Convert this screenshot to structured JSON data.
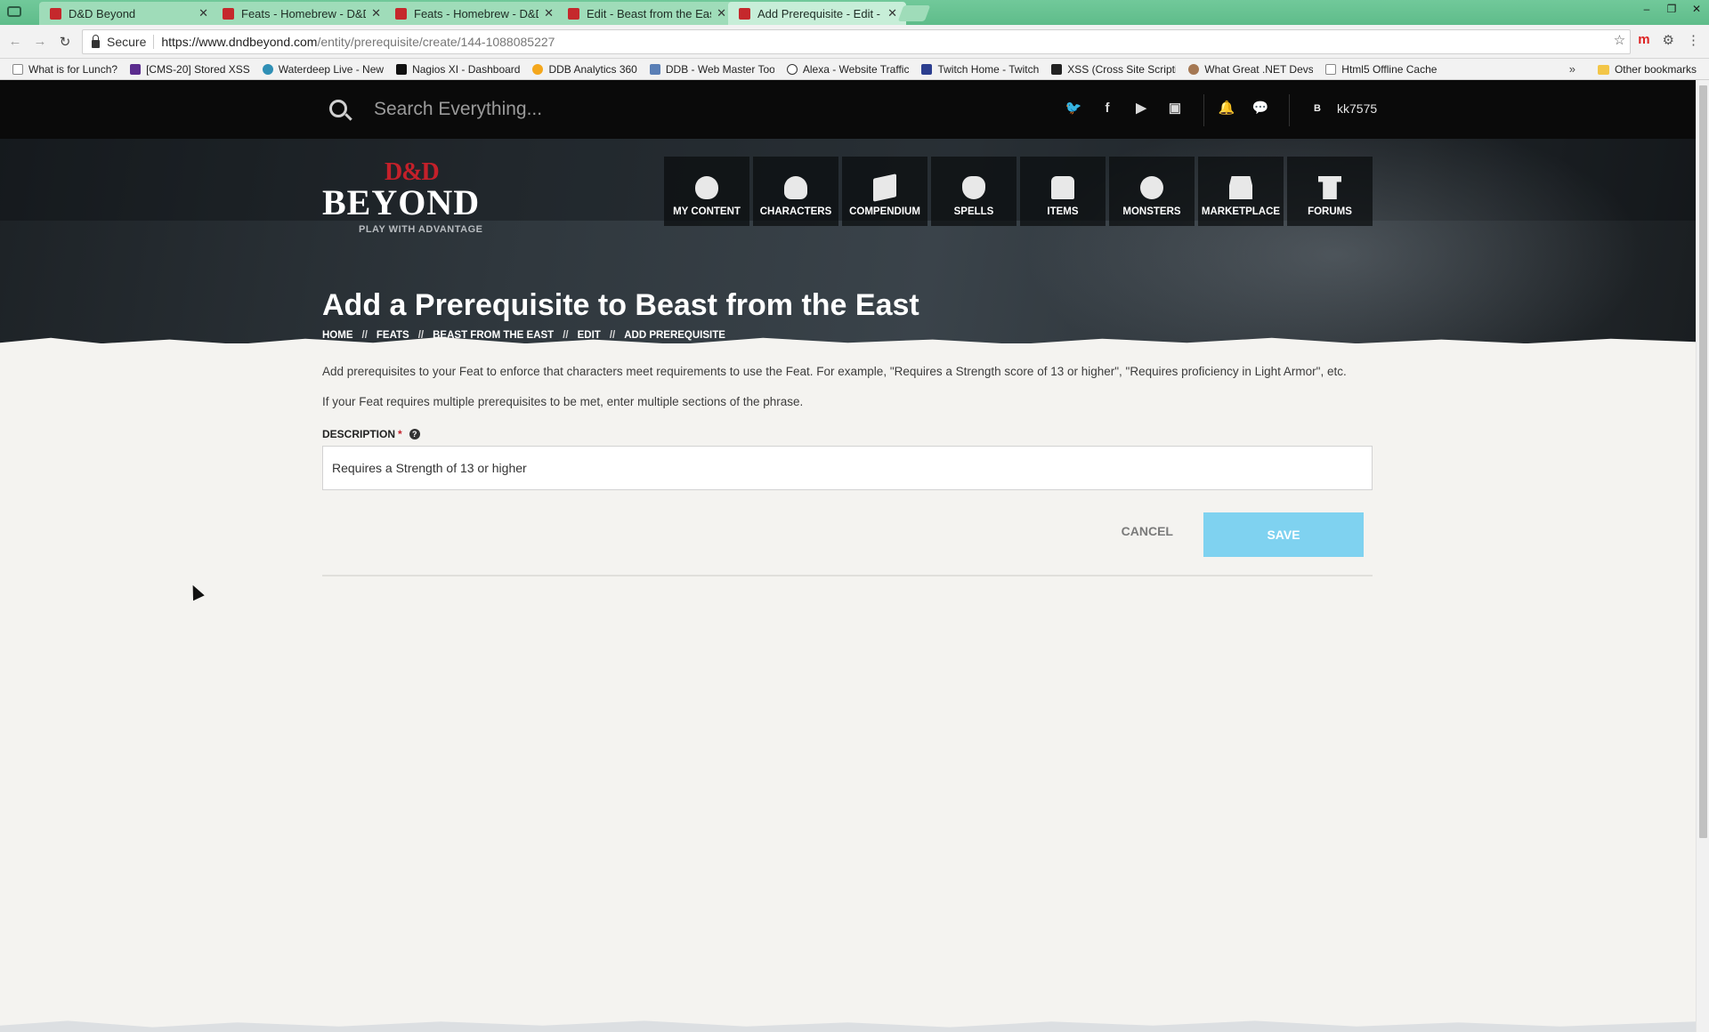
{
  "browser": {
    "tabs": [
      {
        "label": "D&D Beyond"
      },
      {
        "label": "Feats - Homebrew - D&D"
      },
      {
        "label": "Feats - Homebrew - D&D"
      },
      {
        "label": "Edit - Beast from the East"
      },
      {
        "label": "Add Prerequisite - Edit -"
      }
    ],
    "secure_label": "Secure",
    "url_host": "https://www.dndbeyond.com",
    "url_path": "/entity/prerequisite/create/144-1088085227",
    "bookmarks": [
      "What is for Lunch?",
      "[CMS-20] Stored XSS",
      "Waterdeep Live - New",
      "Nagios XI - Dashboard",
      "DDB Analytics 360",
      "DDB - Web Master Tools",
      "Alexa - Website Traffic",
      "Twitch Home - Twitch",
      "XSS (Cross Site Scripting)",
      "What Great .NET Devs",
      "Html5 Offline Cache"
    ],
    "bookmarks_more": "»",
    "other_bookmarks": "Other bookmarks"
  },
  "site": {
    "search_placeholder": "Search Everything...",
    "username": "kk7575",
    "avatar_letter": "B",
    "logo": {
      "top": "D&D",
      "word": "BEYOND",
      "tagline": "PLAY WITH ADVANTAGE"
    },
    "nav": [
      {
        "label": "MY CONTENT",
        "icon": "bag-icon"
      },
      {
        "label": "CHARACTERS",
        "icon": "skull-icon"
      },
      {
        "label": "COMPENDIUM",
        "icon": "book-icon"
      },
      {
        "label": "SPELLS",
        "icon": "hand-icon"
      },
      {
        "label": "ITEMS",
        "icon": "chest-icon"
      },
      {
        "label": "MONSTERS",
        "icon": "shield-icon"
      },
      {
        "label": "MARKETPLACE",
        "icon": "store-icon"
      },
      {
        "label": "FORUMS",
        "icon": "pillar-icon"
      }
    ]
  },
  "page": {
    "title": "Add a Prerequisite to Beast from the East",
    "breadcrumb": [
      "HOME",
      "FEATS",
      "BEAST FROM THE EAST",
      "EDIT",
      "ADD PREREQUISITE"
    ],
    "breadcrumb_sep": "//",
    "intro": "Add prerequisites to your Feat to enforce that characters meet requirements to use the Feat. For example, \"Requires a Strength score of 13 or higher\", \"Requires proficiency in Light Armor\", etc.",
    "intro2": "If your Feat requires multiple prerequisites to be met, enter multiple sections of the phrase.",
    "field_label": "DESCRIPTION",
    "required_mark": "*",
    "help_glyph": "?",
    "description_value": "Requires a Strength of 13 or higher",
    "cancel_label": "CANCEL",
    "save_label": "SAVE"
  },
  "colors": {
    "accent_red": "#c4202a",
    "save_button": "#7fd2f0",
    "topbar": "#0a0a0a"
  }
}
